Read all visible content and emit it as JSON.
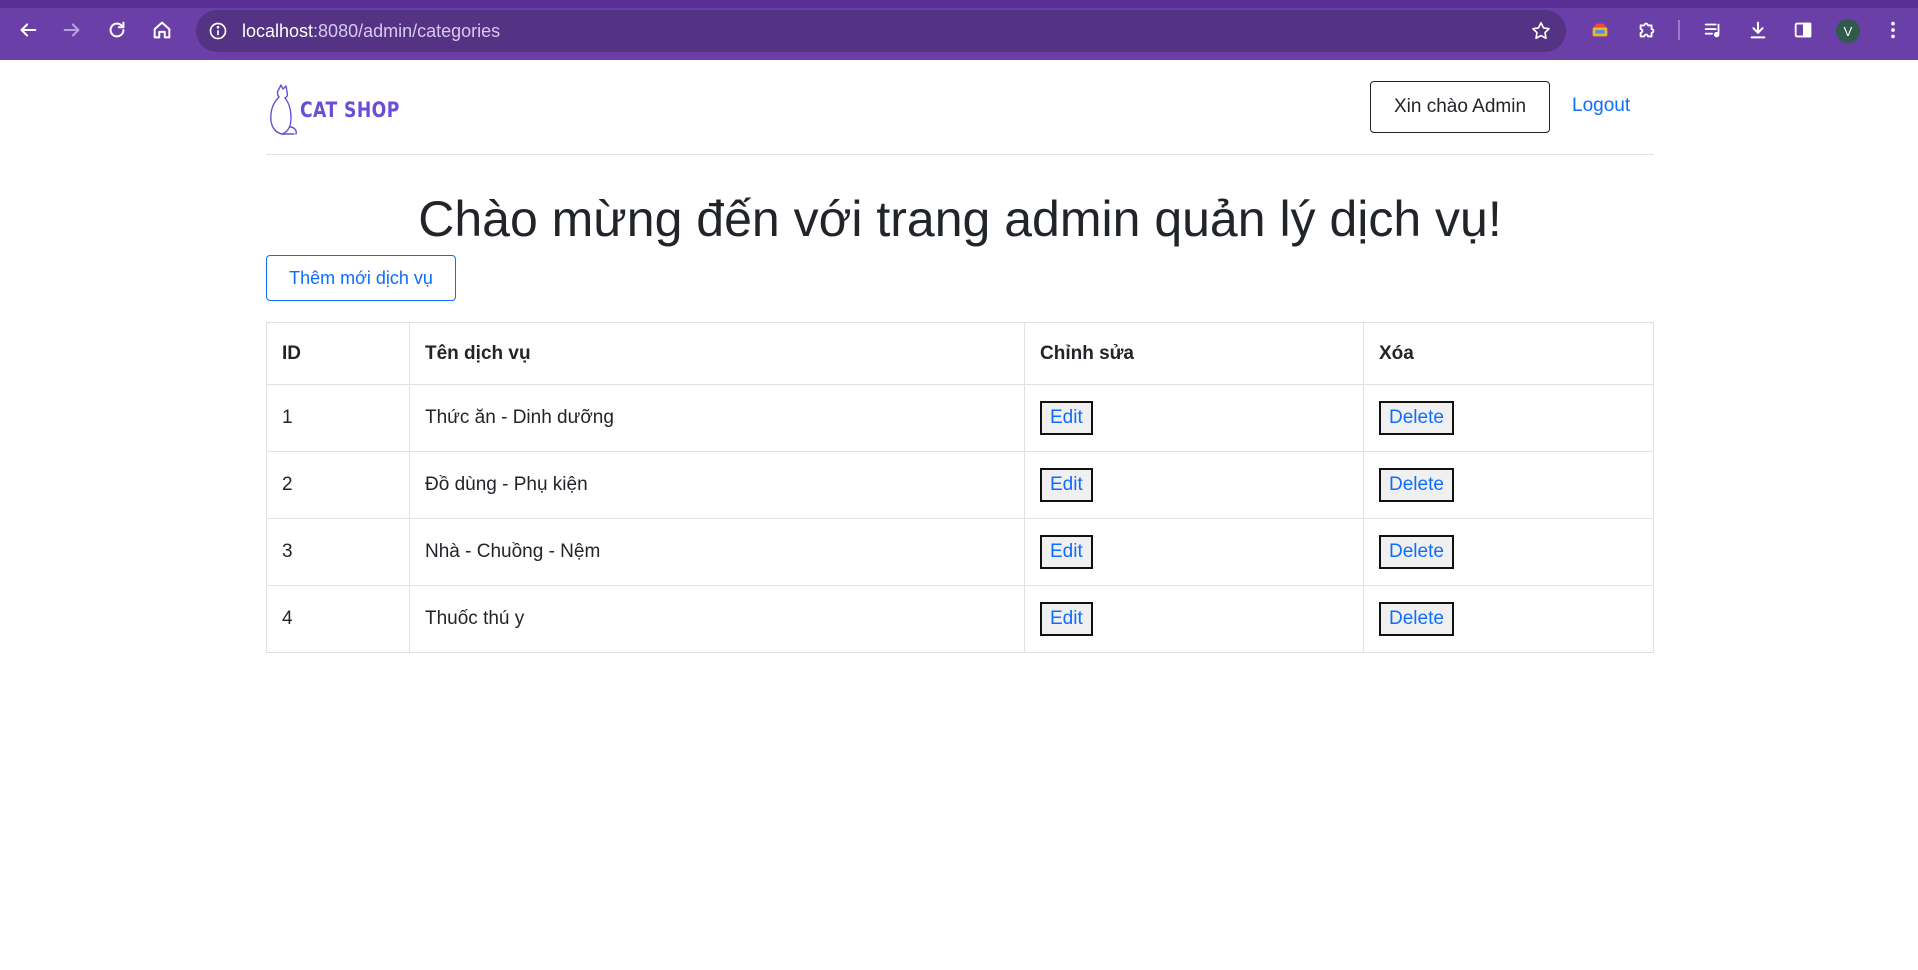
{
  "browser": {
    "url_host": "localhost",
    "url_rest": ":8080/admin/categories",
    "profile_initial": "V"
  },
  "header": {
    "logo_text": "CAT SHOP",
    "greeting": "Xin chào Admin",
    "logout": "Logout"
  },
  "main": {
    "title": "Chào mừng đến với trang admin quản lý dịch vụ!",
    "add_button": "Thêm mới dịch vụ",
    "table": {
      "headers": [
        "ID",
        "Tên dịch vụ",
        "Chỉnh sửa",
        "Xóa"
      ],
      "rows": [
        {
          "id": "1",
          "name": "Thức ăn - Dinh dưỡng",
          "edit": "Edit",
          "delete": "Delete"
        },
        {
          "id": "2",
          "name": "Đồ dùng - Phụ kiện",
          "edit": "Edit",
          "delete": "Delete"
        },
        {
          "id": "3",
          "name": "Nhà - Chuồng - Nệm",
          "edit": "Edit",
          "delete": "Delete"
        },
        {
          "id": "4",
          "name": "Thuốc thú y",
          "edit": "Edit",
          "delete": "Delete"
        }
      ]
    }
  },
  "colors": {
    "browser_frame": "#6b3fa8",
    "omnibox": "#543385",
    "link": "#0d6efd",
    "logo": "#6a4fd6"
  }
}
